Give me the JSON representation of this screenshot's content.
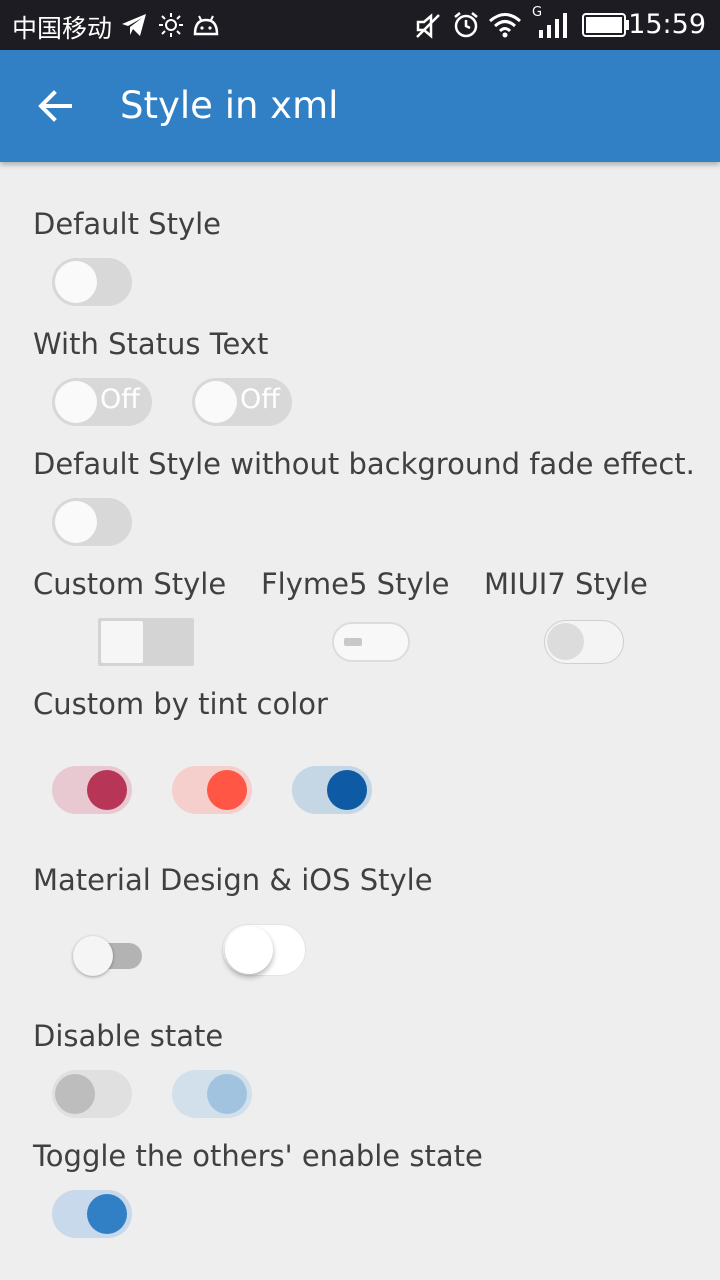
{
  "status_bar": {
    "carrier": "中国移动",
    "time": "15:59",
    "icons": [
      "telegram-icon",
      "brightness-icon",
      "android-icon",
      "mute-icon",
      "alarm-icon",
      "wifi-icon",
      "signal-icon",
      "battery-icon"
    ],
    "network_label": "G"
  },
  "app_bar": {
    "title": "Style in xml",
    "back_icon": "back-arrow-icon"
  },
  "sections": {
    "default_style": {
      "label": "Default Style"
    },
    "status_text": {
      "label": "With Status Text",
      "switch1_text": "Off",
      "switch2_text": "Off"
    },
    "no_fade": {
      "label": "Default Style without background fade effect."
    },
    "custom": {
      "label": "Custom Style",
      "flyme_label": "Flyme5 Style",
      "miui_label": "MIUI7 Style"
    },
    "tint": {
      "label": "Custom by tint color",
      "colors": [
        "#b73557",
        "#ff5645",
        "#0e5aa4"
      ]
    },
    "material_ios": {
      "label": "Material Design & iOS Style"
    },
    "disable": {
      "label": "Disable state"
    },
    "toggle_others": {
      "label": "Toggle the others' enable state"
    }
  },
  "switch_states": {
    "default": false,
    "status_text_1": false,
    "status_text_2": false,
    "no_fade": false,
    "custom": false,
    "flyme": false,
    "miui": false,
    "tint_1": true,
    "tint_2": true,
    "tint_3": true,
    "material": false,
    "ios": false,
    "disabled_1": false,
    "disabled_2": true,
    "toggle_others": true
  },
  "colors": {
    "app_bar": "#3180c5",
    "background": "#eeeeee",
    "accent": "#3180c5"
  }
}
